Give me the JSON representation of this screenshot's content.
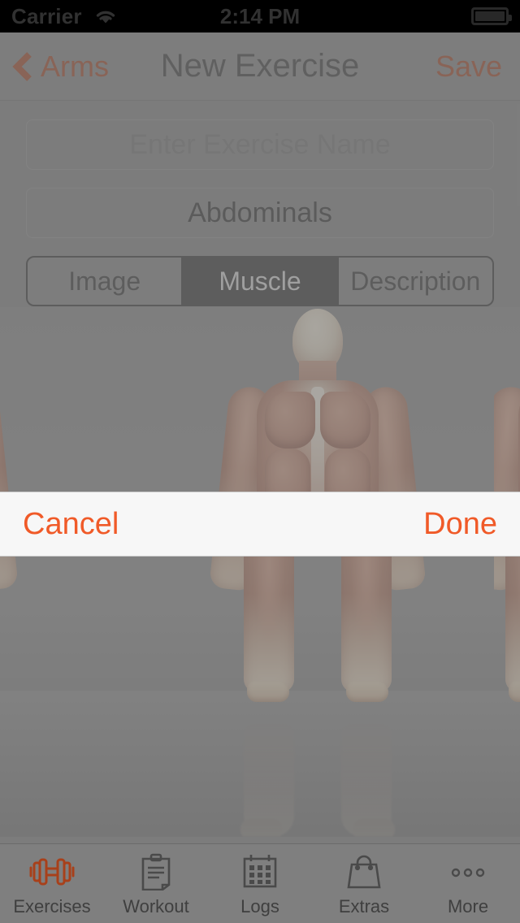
{
  "status_bar": {
    "carrier": "Carrier",
    "wifi_icon": "wifi-icon",
    "time": "2:14 PM",
    "battery_icon": "battery-icon"
  },
  "nav_bar": {
    "back_icon": "chevron-left-icon",
    "back_label": "Arms",
    "title": "New Exercise",
    "save_label": "Save"
  },
  "form": {
    "name_field": {
      "placeholder": "Enter Exercise Name",
      "value": ""
    },
    "muscle_field": {
      "value": "Abdominals"
    }
  },
  "segmented_control": {
    "options": [
      {
        "label": "Image",
        "selected": false
      },
      {
        "label": "Muscle",
        "selected": true
      },
      {
        "label": "Description",
        "selected": false
      }
    ],
    "selected_index": 1
  },
  "carousel": {
    "slides": [
      {
        "name": "anterior-muscle-figure",
        "view": "front"
      },
      {
        "name": "posterior-muscle-figure",
        "view": "back"
      },
      {
        "name": "lateral-muscle-figure",
        "view": "side"
      }
    ],
    "current_index": 1
  },
  "picker_toolbar": {
    "cancel_label": "Cancel",
    "done_label": "Done"
  },
  "tab_bar": {
    "items": [
      {
        "label": "Exercises",
        "icon": "dumbbell-icon",
        "active": true
      },
      {
        "label": "Workout",
        "icon": "clipboard-icon",
        "active": false
      },
      {
        "label": "Logs",
        "icon": "calendar-icon",
        "active": false
      },
      {
        "label": "Extras",
        "icon": "shopping-bag-icon",
        "active": false
      },
      {
        "label": "More",
        "icon": "ellipsis-icon",
        "active": false
      }
    ]
  },
  "colors": {
    "accent_orange": "#f05a28",
    "accent_orange_dimmed": "#9e3d1b",
    "nav_background": "#7f7f7f",
    "segment_selected": "#2b2b2b",
    "toolbar_background": "#f7f7f7",
    "status_background": "#000000"
  }
}
